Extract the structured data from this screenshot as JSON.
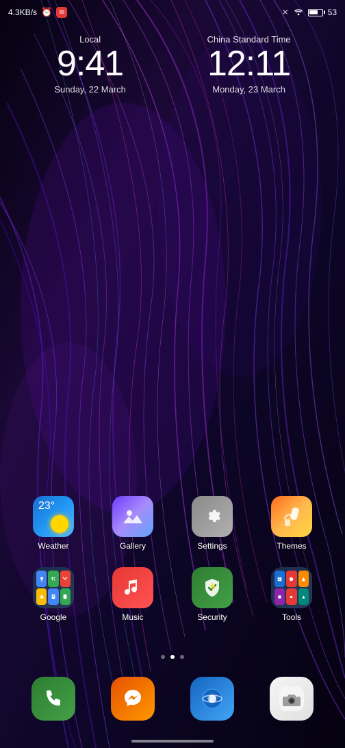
{
  "statusBar": {
    "networkSpeed": "4.3KB/s",
    "battery": "53",
    "batterySymbol": "53"
  },
  "clocks": [
    {
      "label": "Local",
      "time": "9:41",
      "date": "Sunday, 22 March"
    },
    {
      "label": "China Standard Time",
      "time": "12:11",
      "date": "Monday, 23 March"
    }
  ],
  "apps": {
    "row1": [
      {
        "id": "weather",
        "label": "Weather",
        "temp": "23°"
      },
      {
        "id": "gallery",
        "label": "Gallery"
      },
      {
        "id": "settings",
        "label": "Settings"
      },
      {
        "id": "themes",
        "label": "Themes"
      }
    ],
    "row2": [
      {
        "id": "google",
        "label": "Google"
      },
      {
        "id": "music",
        "label": "Music"
      },
      {
        "id": "security",
        "label": "Security"
      },
      {
        "id": "tools",
        "label": "Tools"
      }
    ]
  },
  "dock": [
    {
      "id": "phone",
      "label": "Phone"
    },
    {
      "id": "messenger",
      "label": "Messenger"
    },
    {
      "id": "browser",
      "label": "Browser"
    },
    {
      "id": "camera",
      "label": "Camera"
    }
  ],
  "pageIndicators": [
    {
      "active": false
    },
    {
      "active": true
    },
    {
      "active": false
    }
  ]
}
